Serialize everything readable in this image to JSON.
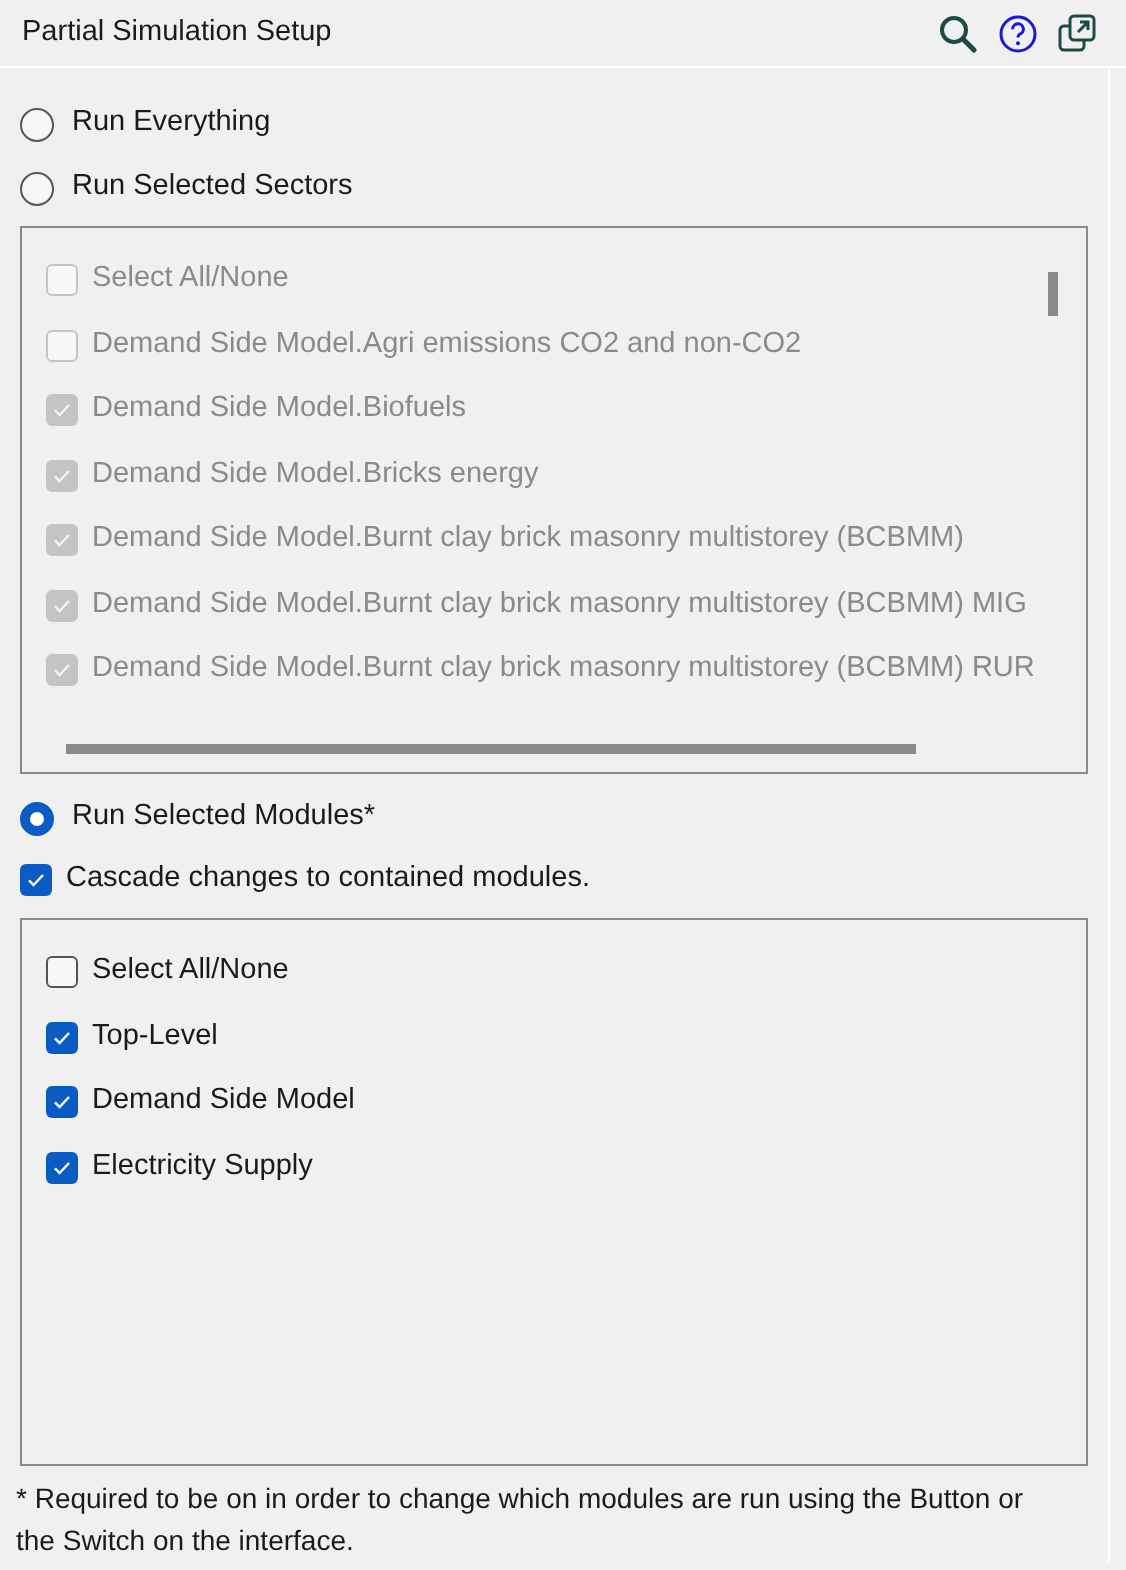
{
  "panel": {
    "title": "Partial Simulation Setup"
  },
  "run_options": [
    {
      "label": "Run Everything",
      "selected": false
    },
    {
      "label": "Run Selected Sectors",
      "selected": false
    }
  ],
  "sectors": {
    "disabled": true,
    "items": [
      {
        "label": "Select All/None",
        "checked": false
      },
      {
        "label": "Demand Side Model.Agri emissions CO2 and non-CO2",
        "checked": false
      },
      {
        "label": "Demand Side Model.Biofuels",
        "checked": true
      },
      {
        "label": "Demand Side Model.Bricks energy",
        "checked": true
      },
      {
        "label": "Demand Side Model.Burnt clay brick masonry multistorey (BCBMM)",
        "checked": true
      },
      {
        "label": "Demand Side Model.Burnt clay brick masonry multistorey (BCBMM) MIG",
        "checked": true
      },
      {
        "label": "Demand Side Model.Burnt clay brick masonry multistorey (BCBMM) RUR",
        "checked": true
      }
    ]
  },
  "modules_option": {
    "label": "Run Selected Modules*",
    "selected": true
  },
  "cascade": {
    "label": "Cascade changes to contained modules.",
    "checked": true
  },
  "modules": {
    "disabled": false,
    "items": [
      {
        "label": "Select All/None",
        "checked": false
      },
      {
        "label": "Top-Level",
        "checked": true
      },
      {
        "label": "Demand Side Model",
        "checked": true
      },
      {
        "label": "Electricity Supply",
        "checked": true
      }
    ]
  },
  "footnote": "* Required to be on in order to change which modules are run using the Button or the Switch on the interface."
}
